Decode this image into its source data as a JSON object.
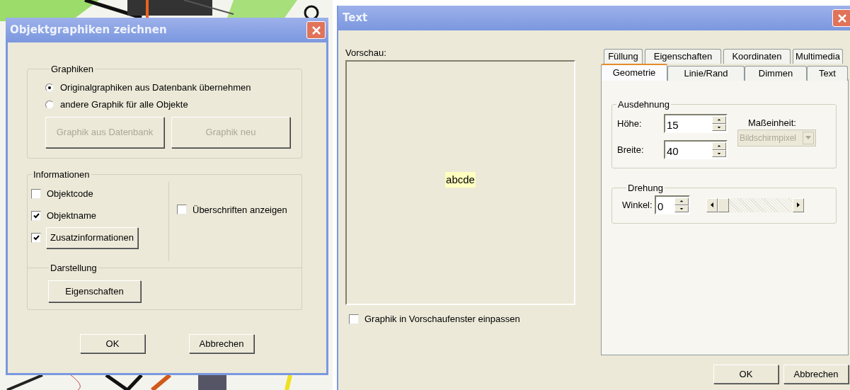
{
  "objektgraphiken_dialog": {
    "title": "Objektgraphiken zeichnen",
    "graphiken": {
      "label": "Graphiken",
      "options": [
        {
          "label": "Originalgraphiken aus Datenbank übernehmen",
          "selected": true
        },
        {
          "label": "andere Graphik für alle Objekte",
          "selected": false
        }
      ],
      "buttons": [
        {
          "label": "Graphik aus Datenbank",
          "disabled": true
        },
        {
          "label": "Graphik neu",
          "disabled": true
        }
      ]
    },
    "informationen": {
      "label": "Informationen",
      "items": [
        {
          "kind": "label",
          "label": "Objektcode",
          "checked": false
        },
        {
          "kind": "label",
          "label": "Objektname",
          "checked": true
        },
        {
          "kind": "button",
          "label": "Zusatzinformationen",
          "checked": true
        }
      ],
      "headings": {
        "label": "Überschriften anzeigen",
        "checked": false
      }
    },
    "darstellung": {
      "label": "Darstellung",
      "button": "Eigenschaften"
    },
    "buttons": [
      "OK",
      "Abbrechen"
    ]
  },
  "text_dialog": {
    "title": "Text",
    "preview_label": "Vorschau:",
    "preview_text": "abcde",
    "fit": {
      "label": "Graphik in Vorschaufenster einpassen",
      "checked": false
    },
    "tab_rows": [
      [
        {
          "label": "Füllung",
          "selected": false
        },
        {
          "label": "Eigenschaften",
          "selected": false
        },
        {
          "label": "Koordinaten",
          "selected": false
        },
        {
          "label": "Multimedia",
          "selected": false
        }
      ],
      [
        {
          "label": "Geometrie",
          "selected": true
        },
        {
          "label": "Linie/Rand",
          "selected": false
        },
        {
          "label": "Dimmen",
          "selected": false
        },
        {
          "label": "Text",
          "selected": false
        }
      ]
    ],
    "ausdehnung": {
      "label": "Ausdehnung",
      "fields": [
        {
          "label": "Höhe:",
          "value": "15"
        },
        {
          "label": "Breite:",
          "value": "40"
        }
      ],
      "unit_label": "Maßeinheit:",
      "unit_value": "Bildschirmpixel",
      "unit_disabled": true
    },
    "drehung": {
      "label": "Drehung",
      "angle_label": "Winkel:",
      "angle_value": "0",
      "slider": {
        "level": 0
      }
    },
    "buttons": [
      "OK",
      "Abbrechen"
    ]
  }
}
